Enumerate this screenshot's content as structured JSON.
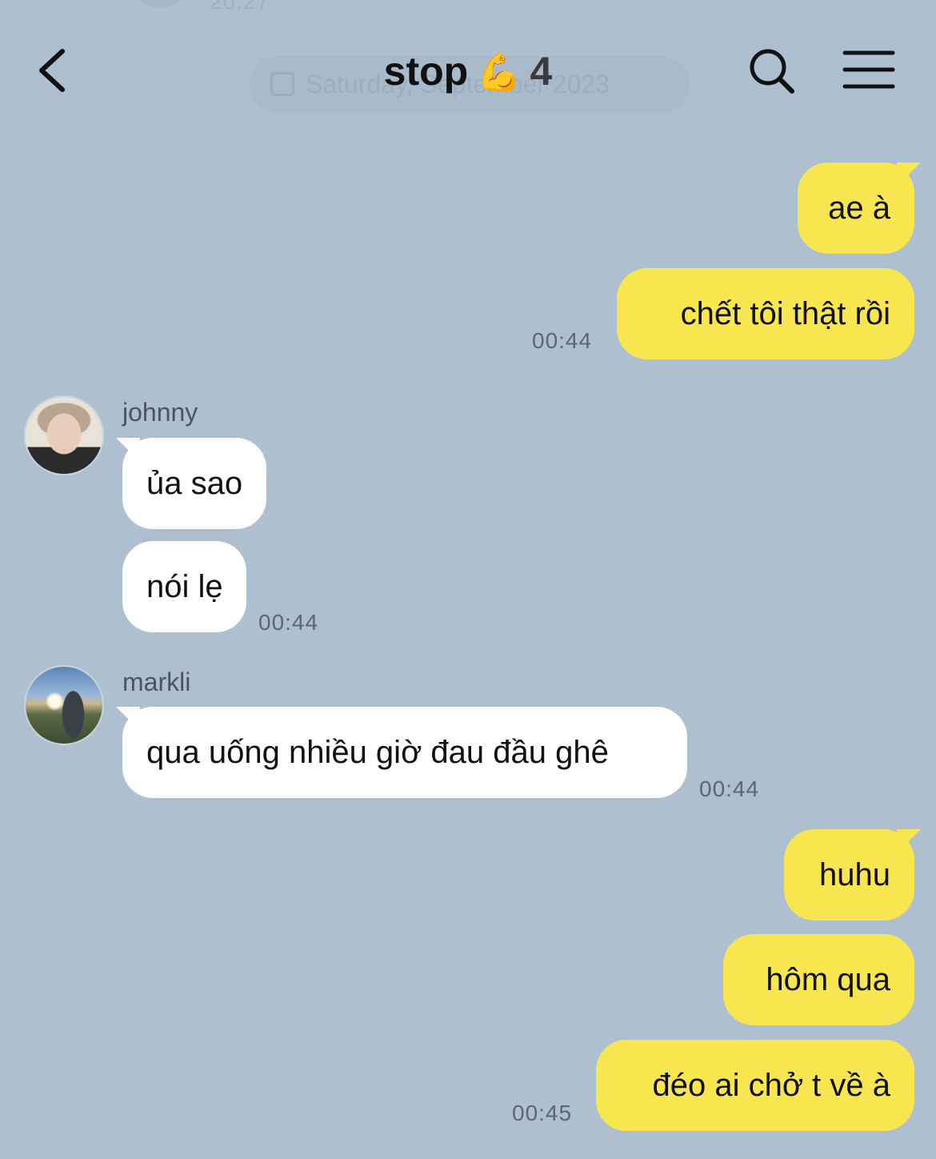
{
  "header": {
    "title": "stop",
    "emoji": "💪",
    "member_count": "4"
  },
  "background": {
    "faded_time": "20:27",
    "faded_date": "Saturday, September 2023"
  },
  "colors": {
    "background": "#aebfcf",
    "outgoing_bubble": "#f7e64f",
    "incoming_bubble": "#ffffff"
  },
  "messages": {
    "m1": {
      "text": "ae à"
    },
    "m2": {
      "text": "chết tôi thật rồi",
      "time": "00:44"
    },
    "johnny": {
      "name": "johnny",
      "m1": "ủa sao",
      "m2": "nói lẹ",
      "time": "00:44"
    },
    "markli": {
      "name": "markli",
      "m1": "qua uống nhiều giờ đau đầu ghê",
      "time": "00:44"
    },
    "m3": {
      "text": "huhu"
    },
    "m4": {
      "text": "hôm qua"
    },
    "m5": {
      "text": "đéo ai chở t về à",
      "time": "00:45"
    }
  }
}
